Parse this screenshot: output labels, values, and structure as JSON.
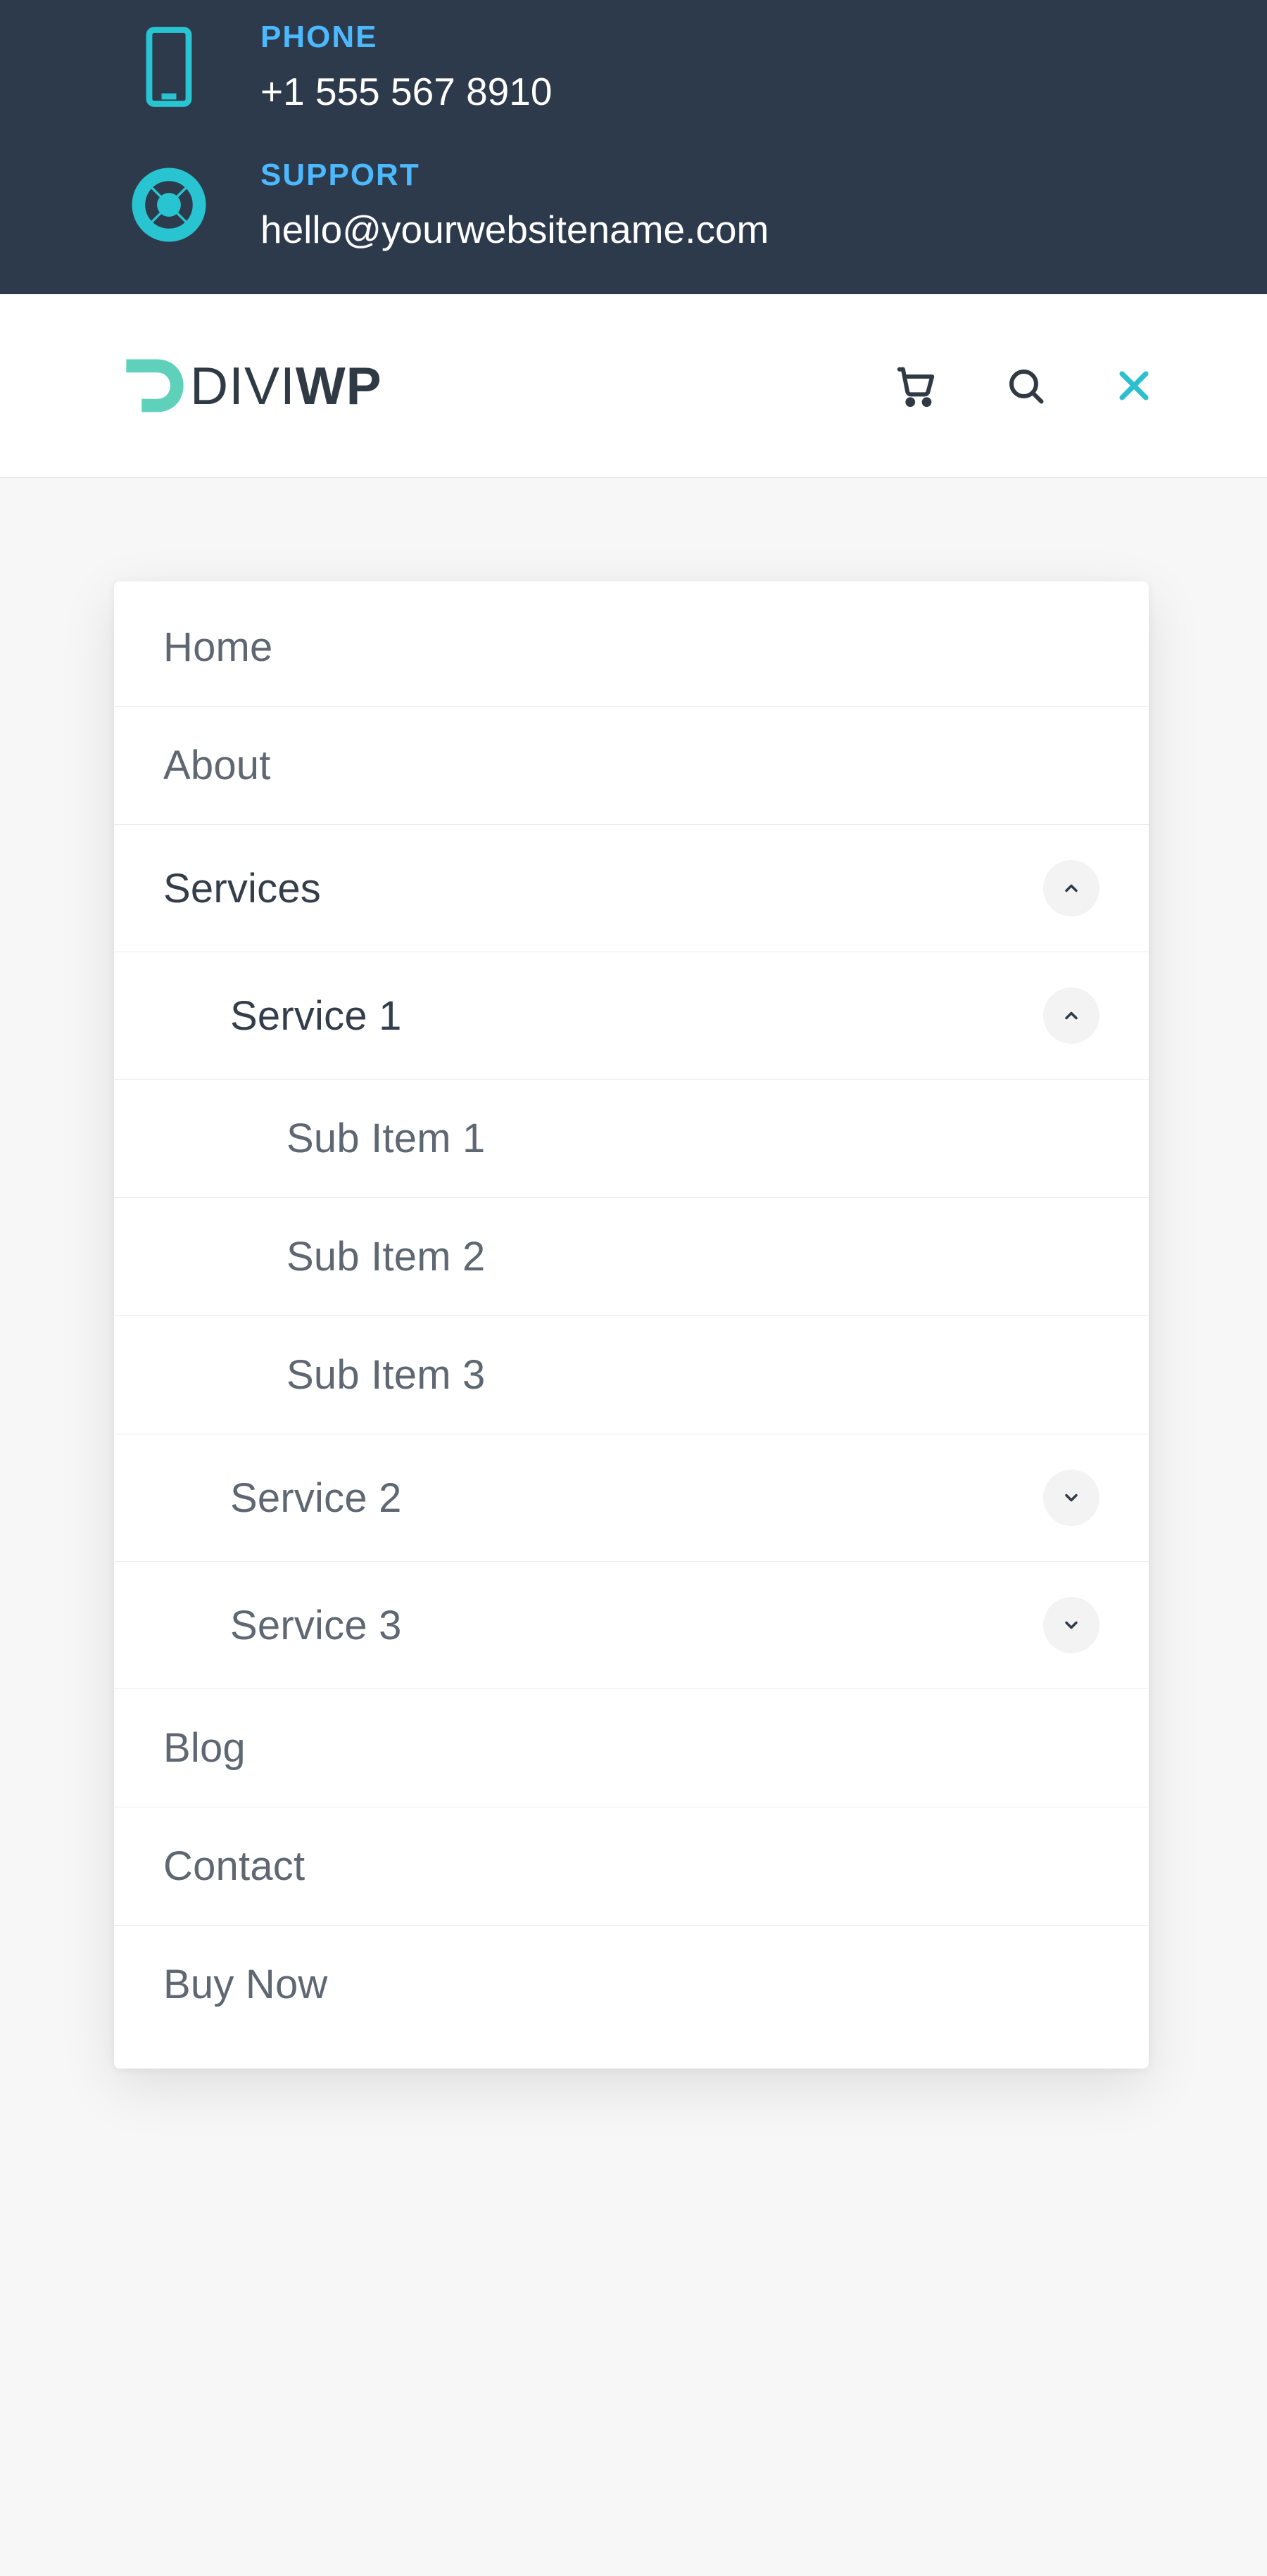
{
  "topbar": {
    "phone": {
      "label": "PHONE",
      "value": "+1 555 567 8910"
    },
    "support": {
      "label": "SUPPORT",
      "value": "hello@yourwebsitename.com"
    }
  },
  "brand": {
    "part1": "DIVI",
    "part2": "WP"
  },
  "menu": {
    "home": "Home",
    "about": "About",
    "services": "Services",
    "service1": "Service 1",
    "sub1": "Sub Item 1",
    "sub2": "Sub Item 2",
    "sub3": "Sub Item 3",
    "service2": "Service 2",
    "service3": "Service 3",
    "blog": "Blog",
    "contact": "Contact",
    "buynow": "Buy Now"
  }
}
